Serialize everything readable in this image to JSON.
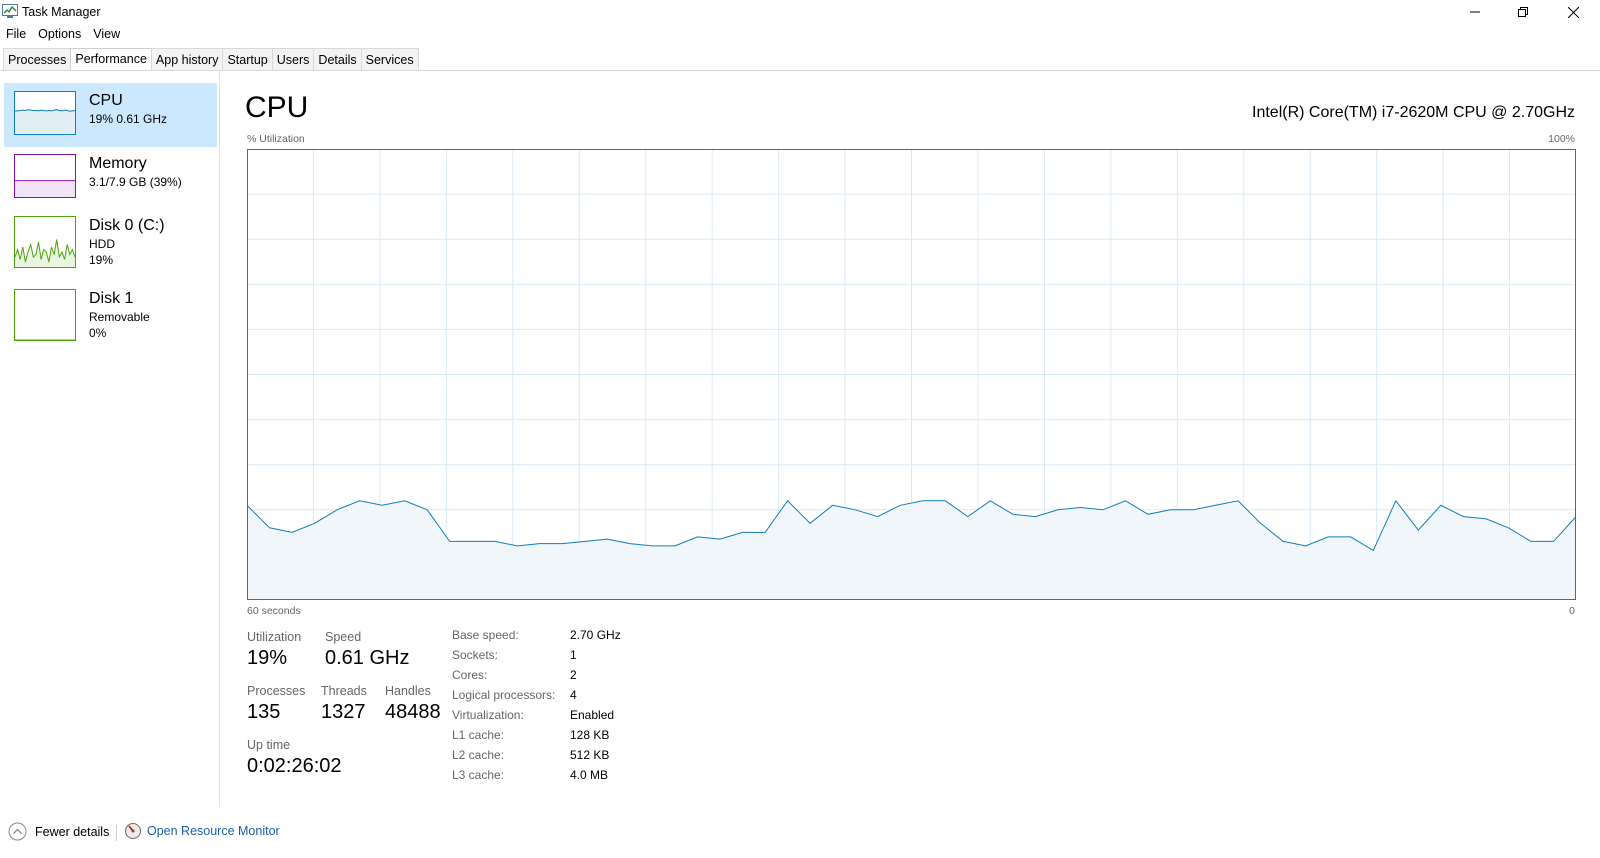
{
  "window": {
    "title": "Task Manager"
  },
  "menu": [
    "File",
    "Options",
    "View"
  ],
  "tabs": [
    "Processes",
    "Performance",
    "App history",
    "Startup",
    "Users",
    "Details",
    "Services"
  ],
  "active_tab": "Performance",
  "resources": [
    {
      "name": "CPU",
      "lines": [
        "19% 0.61 GHz"
      ],
      "color": "#117dbb",
      "selected": true,
      "history": [
        55,
        55,
        56,
        57,
        56,
        58,
        57,
        56,
        56,
        55,
        57,
        56,
        55,
        56,
        55,
        57,
        58,
        56,
        55,
        57,
        56,
        54,
        55,
        56
      ]
    },
    {
      "name": "Memory",
      "lines": [
        "3.1/7.9 GB (39%)"
      ],
      "color": "#8b12ae",
      "selected": false,
      "history": [
        39,
        39,
        39,
        39,
        39,
        39,
        39,
        39,
        39,
        39,
        39,
        39,
        39,
        39,
        39,
        39,
        39,
        39,
        39,
        39,
        39,
        39,
        39,
        39
      ]
    },
    {
      "name": "Disk 0 (C:)",
      "lines": [
        "HDD",
        "19%"
      ],
      "color": "#4da60c",
      "selected": false,
      "history": [
        20,
        35,
        15,
        40,
        10,
        30,
        45,
        20,
        25,
        50,
        15,
        35,
        30,
        10,
        40,
        25,
        55,
        20,
        30,
        15,
        45,
        25,
        35,
        20
      ]
    },
    {
      "name": "Disk 1",
      "lines": [
        "Removable",
        "0%"
      ],
      "color": "#4da60c",
      "selected": false,
      "history": [
        0,
        0,
        0,
        0,
        0,
        0,
        0,
        0,
        0,
        0,
        0,
        0,
        0,
        0,
        0,
        0,
        0,
        0,
        0,
        0,
        0,
        0,
        0,
        0
      ]
    }
  ],
  "main": {
    "title": "CPU",
    "model": "Intel(R) Core(TM) i7-2620M CPU @ 2.70GHz",
    "util_label": "% Utilization",
    "util_max": "100%",
    "time_left": "60 seconds",
    "time_right": "0"
  },
  "chart_data": {
    "type": "area",
    "ylabel": "% Utilization",
    "ylim": [
      0,
      100
    ],
    "xlabel": "60 seconds",
    "x": [
      60,
      59,
      58,
      57,
      56,
      55,
      54,
      53,
      52,
      51,
      50,
      49,
      48,
      47,
      46,
      45,
      44,
      43,
      42,
      41,
      40,
      39,
      38,
      37,
      36,
      35,
      34,
      33,
      32,
      31,
      30,
      29,
      28,
      27,
      26,
      25,
      24,
      23,
      22,
      21,
      20,
      19,
      18,
      17,
      16,
      15,
      14,
      13,
      12,
      11,
      10,
      9,
      8,
      7,
      6,
      5,
      4,
      3,
      2,
      1,
      0
    ],
    "values": [
      21,
      16,
      15,
      17,
      20,
      22,
      21,
      22,
      20,
      13,
      13,
      13,
      12,
      12.5,
      12.5,
      13,
      13.5,
      12.5,
      12,
      12,
      14,
      13.5,
      15,
      15,
      22,
      17,
      21,
      20,
      18.5,
      21,
      22,
      22,
      18.5,
      22,
      19,
      18.5,
      20,
      20.5,
      20,
      22,
      19,
      20,
      20,
      21,
      22,
      17,
      13,
      12,
      14,
      14,
      11,
      22,
      15.5,
      21,
      18.5,
      18,
      16,
      13,
      13,
      18.5
    ],
    "series_color": "#117dbb",
    "grid": true
  },
  "stats": {
    "utilization": {
      "label": "Utilization",
      "value": "19%"
    },
    "speed": {
      "label": "Speed",
      "value": "0.61 GHz"
    },
    "processes": {
      "label": "Processes",
      "value": "135"
    },
    "threads": {
      "label": "Threads",
      "value": "1327"
    },
    "handles": {
      "label": "Handles",
      "value": "48488"
    },
    "uptime": {
      "label": "Up time",
      "value": "0:02:26:02"
    }
  },
  "specs": [
    {
      "key": "Base speed:",
      "value": "2.70 GHz"
    },
    {
      "key": "Sockets:",
      "value": "1"
    },
    {
      "key": "Cores:",
      "value": "2"
    },
    {
      "key": "Logical processors:",
      "value": "4"
    },
    {
      "key": "Virtualization:",
      "value": "Enabled"
    },
    {
      "key": "L1 cache:",
      "value": "128 KB"
    },
    {
      "key": "L2 cache:",
      "value": "512 KB"
    },
    {
      "key": "L3 cache:",
      "value": "4.0 MB"
    }
  ],
  "footer": {
    "fewer_details": "Fewer details",
    "open_resource_monitor": "Open Resource Monitor"
  }
}
